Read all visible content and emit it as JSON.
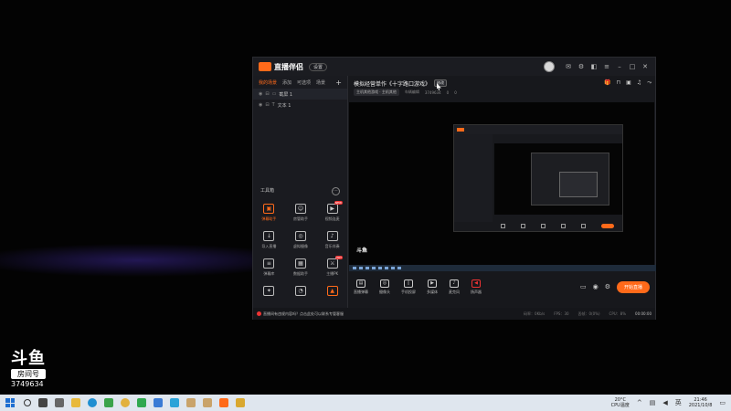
{
  "desktop": {
    "logo_text": "斗鱼",
    "room_label": "房间号",
    "room_number": "3749634"
  },
  "app": {
    "brand": "直播伴侣",
    "version_pill": "设置",
    "left": {
      "tabs": [
        "我的场景",
        "添加",
        "可选项",
        "场景"
      ],
      "sources": [
        {
          "label": "截屏 1"
        },
        {
          "label": "文本 1"
        }
      ],
      "tools_title": "工具箱",
      "tools": [
        {
          "label": "弹幕助手",
          "icon": "game-icon",
          "hot": true
        },
        {
          "label": "房管助手",
          "icon": "user-icon",
          "hot": false
        },
        {
          "label": "视频连麦",
          "icon": "video-icon",
          "hot": false,
          "badge": "NEW"
        },
        {
          "label": "导入直播",
          "icon": "download-icon",
          "hot": false
        },
        {
          "label": "虚拟摄像",
          "icon": "camera-icon",
          "hot": false
        },
        {
          "label": "音乐伴奏",
          "icon": "music-icon",
          "hot": false
        },
        {
          "label": "弹幕库",
          "icon": "list-icon",
          "hot": false
        },
        {
          "label": "数据助手",
          "icon": "chart-icon",
          "hot": false
        },
        {
          "label": "主播PK",
          "icon": "pk-icon",
          "hot": false,
          "badge": "HOT"
        },
        {
          "label": "",
          "icon": "gift-icon",
          "hot": false
        },
        {
          "label": "",
          "icon": "bell-icon",
          "hot": false
        },
        {
          "label": "",
          "icon": "fire-icon",
          "hot": true
        }
      ]
    },
    "center": {
      "room_title": "模拟经营单作《十字路口游戏》",
      "edit_label": "修改",
      "category": "主机其他游戏 · 主机其他",
      "meta_label": "车辆编辑",
      "room_id": "3749634",
      "fans": "0",
      "viewers": "0",
      "preview_logo": "斗鱼"
    },
    "toolbar": {
      "buttons": [
        {
          "label": "直播弹幕",
          "icon": "danmu-icon"
        },
        {
          "label": "摄像头",
          "icon": "webcam-icon"
        },
        {
          "label": "手机投屏",
          "icon": "phone-icon"
        },
        {
          "label": "多媒体",
          "icon": "media-icon"
        },
        {
          "label": "麦克风",
          "icon": "mic-icon"
        },
        {
          "label": "扬声器",
          "icon": "speaker-icon"
        }
      ],
      "live_button": "开始直播"
    },
    "status": {
      "notice": "直播间有违规内容吗？点击此处可以联系专管客服",
      "bitrate": "码率：0Kb/s",
      "fps": "FPS：30",
      "drop": "丢帧：0(0%)",
      "cpu": "CPU：8%",
      "time": "00:00:00"
    }
  },
  "taskbar": {
    "weather_temp": "20°C",
    "weather_label": "CPU温度",
    "time": "21:46",
    "date": "2021/10/8"
  }
}
